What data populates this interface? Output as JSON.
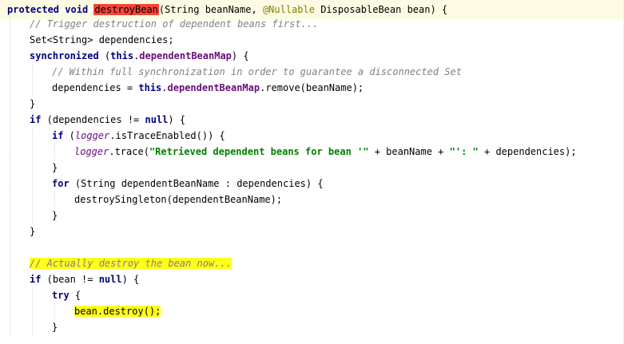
{
  "editor": {
    "language": "java",
    "colors": {
      "keyword": "#000080",
      "comment": "#808080",
      "string": "#008000",
      "field": "#660e7a",
      "annotation": "#808000",
      "selected_method_bg": "#f4453b",
      "marker_highlight": "#ffff1a",
      "current_line_bg": "#fdfbe3"
    },
    "lines": [
      {
        "indent": 0,
        "current": true,
        "tokens": [
          {
            "t": "protected",
            "c": "kw"
          },
          {
            "t": " "
          },
          {
            "t": "void",
            "c": "kw"
          },
          {
            "t": " "
          },
          {
            "t": "destroyBean",
            "c": "sel-name"
          },
          {
            "t": "(String beanName, "
          },
          {
            "t": "@Nullable",
            "c": "ann"
          },
          {
            "t": " DisposableBean bean) {"
          }
        ]
      },
      {
        "indent": 1,
        "tokens": [
          {
            "t": "// Trigger destruction of dependent beans first...",
            "c": "cm"
          }
        ]
      },
      {
        "indent": 1,
        "tokens": [
          {
            "t": "Set<String> dependencies;"
          }
        ]
      },
      {
        "indent": 1,
        "tokens": [
          {
            "t": "synchronized",
            "c": "kw"
          },
          {
            "t": " ("
          },
          {
            "t": "this",
            "c": "kw"
          },
          {
            "t": "."
          },
          {
            "t": "dependentBeanMap",
            "c": "fld"
          },
          {
            "t": ") {"
          }
        ]
      },
      {
        "indent": 2,
        "tokens": [
          {
            "t": "// Within full synchronization in order to guarantee a disconnected Set",
            "c": "cm"
          }
        ]
      },
      {
        "indent": 2,
        "tokens": [
          {
            "t": "dependencies = "
          },
          {
            "t": "this",
            "c": "kw"
          },
          {
            "t": "."
          },
          {
            "t": "dependentBeanMap",
            "c": "fld"
          },
          {
            "t": ".remove(beanName);"
          }
        ]
      },
      {
        "indent": 1,
        "tokens": [
          {
            "t": "}"
          }
        ]
      },
      {
        "indent": 1,
        "tokens": [
          {
            "t": "if",
            "c": "kw"
          },
          {
            "t": " (dependencies != "
          },
          {
            "t": "null",
            "c": "kw"
          },
          {
            "t": ") {"
          }
        ]
      },
      {
        "indent": 2,
        "tokens": [
          {
            "t": "if",
            "c": "kw"
          },
          {
            "t": " ("
          },
          {
            "t": "logger",
            "c": "stfld"
          },
          {
            "t": ".isTraceEnabled()) {"
          }
        ]
      },
      {
        "indent": 3,
        "tokens": [
          {
            "t": "logger",
            "c": "stfld"
          },
          {
            "t": ".trace("
          },
          {
            "t": "\"Retrieved dependent beans for bean '\"",
            "c": "st"
          },
          {
            "t": " + beanName + "
          },
          {
            "t": "\"': \"",
            "c": "st"
          },
          {
            "t": " + dependencies);"
          }
        ]
      },
      {
        "indent": 2,
        "tokens": [
          {
            "t": "}"
          }
        ]
      },
      {
        "indent": 2,
        "tokens": [
          {
            "t": "for",
            "c": "kw"
          },
          {
            "t": " (String dependentBeanName : dependencies) {"
          }
        ]
      },
      {
        "indent": 3,
        "tokens": [
          {
            "t": "destroySingleton(dependentBeanName);"
          }
        ]
      },
      {
        "indent": 2,
        "tokens": [
          {
            "t": "}"
          }
        ]
      },
      {
        "indent": 1,
        "tokens": [
          {
            "t": "}"
          }
        ]
      },
      {
        "indent": 1,
        "tokens": []
      },
      {
        "indent": 1,
        "tokens": [
          {
            "t": "// Actually destroy the bean now...",
            "c": "cm",
            "hl": true
          }
        ]
      },
      {
        "indent": 1,
        "tokens": [
          {
            "t": "if",
            "c": "kw"
          },
          {
            "t": " (bean != "
          },
          {
            "t": "null",
            "c": "kw"
          },
          {
            "t": ") {"
          }
        ]
      },
      {
        "indent": 2,
        "tokens": [
          {
            "t": "try",
            "c": "kw"
          },
          {
            "t": " {"
          }
        ]
      },
      {
        "indent": 3,
        "tokens": [
          {
            "t": "bean.destroy();",
            "hl": true
          }
        ]
      },
      {
        "indent": 2,
        "tokens": [
          {
            "t": "}"
          }
        ]
      }
    ]
  }
}
